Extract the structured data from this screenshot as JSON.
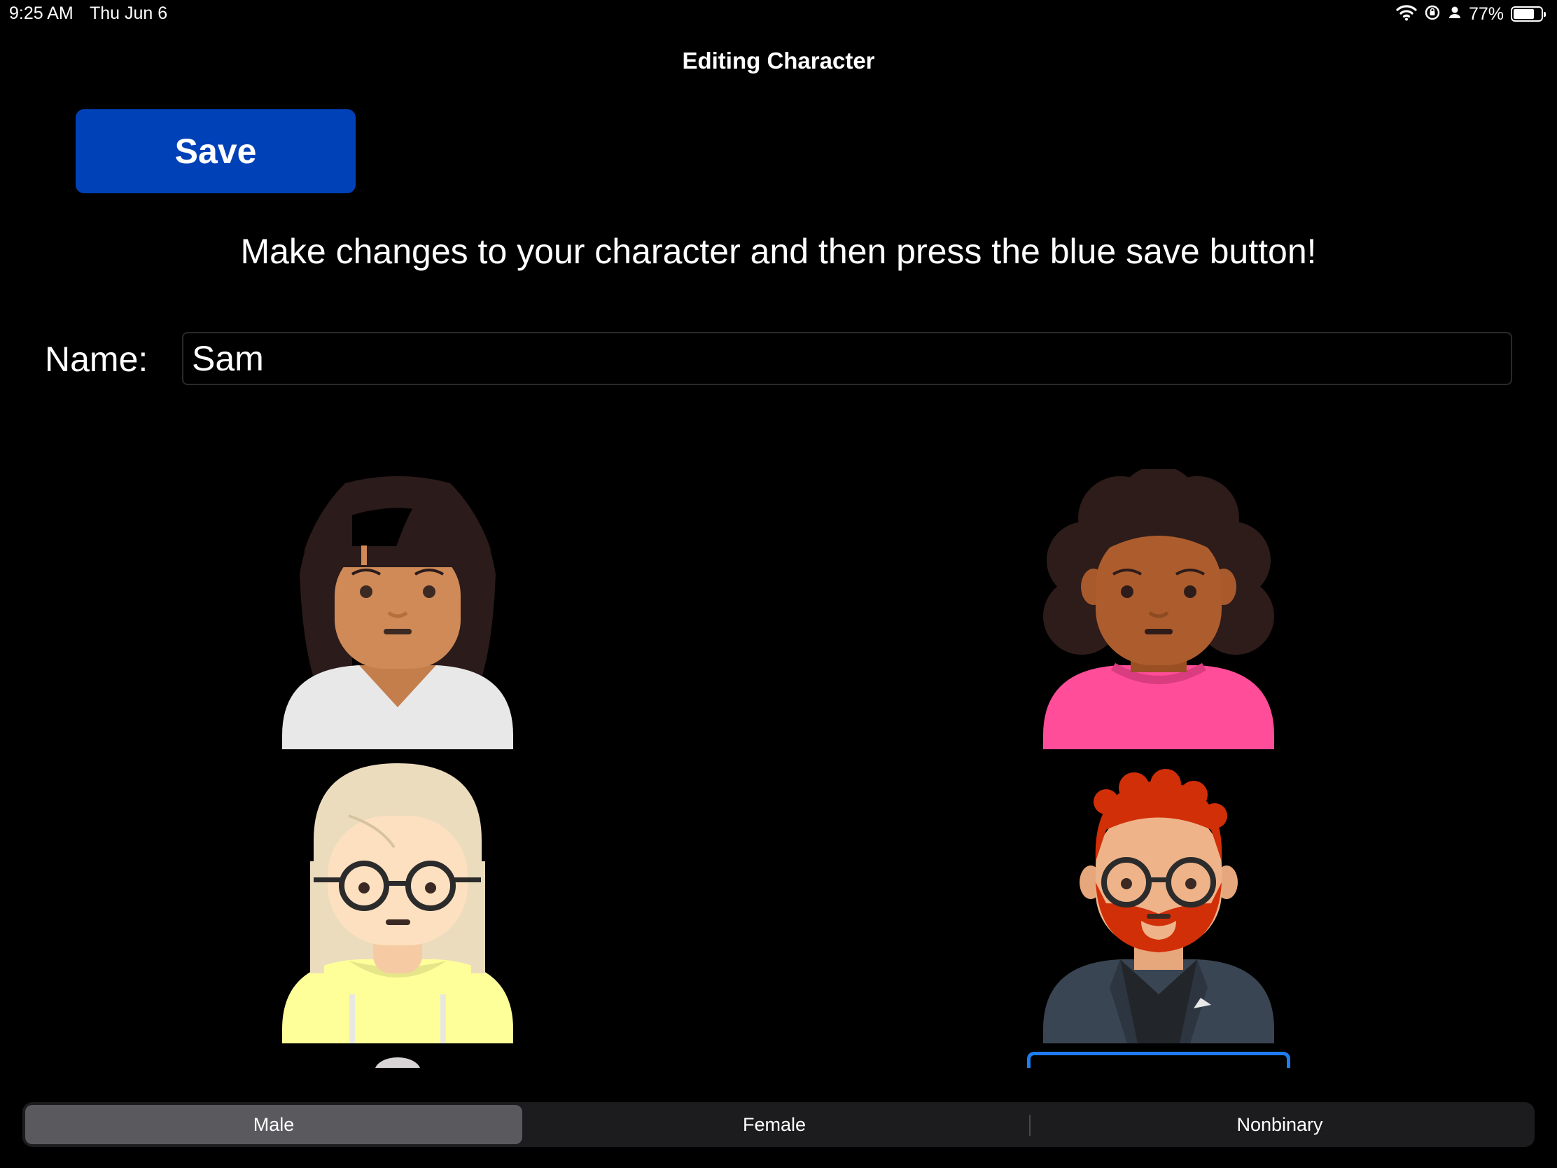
{
  "status_bar": {
    "time": "9:25 AM",
    "date": "Thu Jun 6",
    "battery_pct": "77%",
    "battery_level": 0.77,
    "icons": [
      "wifi-icon",
      "orientation-lock-icon",
      "person-icon",
      "battery-icon"
    ]
  },
  "nav": {
    "title": "Editing Character"
  },
  "save_button": {
    "label": "Save",
    "color": "#0041b8"
  },
  "instructions": "Make changes to your character and then press the blue save button!",
  "name_field": {
    "label": "Name:",
    "value": "Sam"
  },
  "avatars": [
    {
      "name": "avatar-straight-dark-hair-white-shirt"
    },
    {
      "name": "avatar-curly-hair-pink-shirt"
    },
    {
      "name": "avatar-blonde-glasses-yellow-hoodie"
    },
    {
      "name": "avatar-red-beard-glasses-blazer"
    }
  ],
  "gender_picker": {
    "options": [
      "Male",
      "Female",
      "Nonbinary"
    ],
    "selected": "Male"
  },
  "accent_color": "#1f7cf0"
}
